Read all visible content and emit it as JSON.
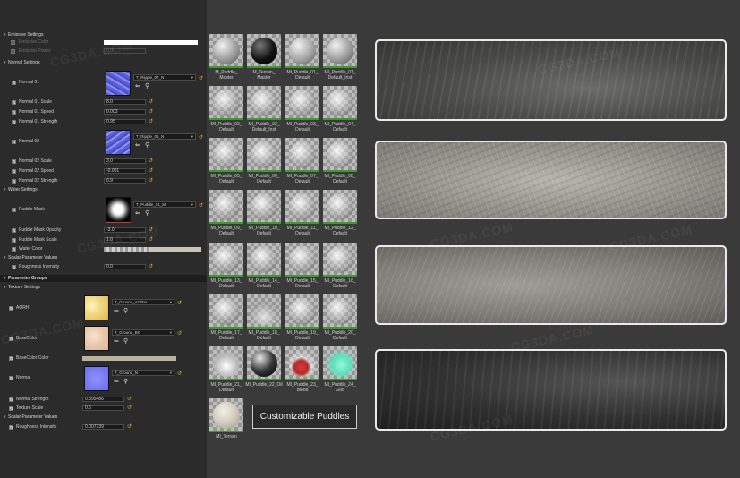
{
  "left_panel": {
    "emissive": {
      "section": "Emissive Settings",
      "color_label": "Emissive Color",
      "power_label": "Emissive Power",
      "power_value": "0.0"
    },
    "normal": {
      "section": "Normal Settings",
      "n1_label": "Normal 01",
      "n1_texture": "T_Ripple_07_N",
      "n1_scale_label": "Normal 01 Scale",
      "n1_scale": "8.0",
      "n1_speed_label": "Normal 01 Speed",
      "n1_speed": "0.003",
      "n1_strength_label": "Normal 01 Strength",
      "n1_strength": "0.95",
      "n2_label": "Normal 02",
      "n2_texture": "T_Ripple_05_N",
      "n2_scale_label": "Normal 02 Scale",
      "n2_scale": "3.0",
      "n2_speed_label": "Normal 02 Speed",
      "n2_speed": "-0.001",
      "n2_strength_label": "Normal 02 Strength",
      "n2_strength": "0.9"
    },
    "water": {
      "section": "Water Settings",
      "mask_label": "Puddle Mask",
      "mask_texture": "T_Puddle_01_M",
      "opacity_label": "Puddle Mask Opacity",
      "opacity": "-3.0",
      "mscale_label": "Puddle Mask Scale",
      "mscale": "1.0",
      "color_label": "Water Color"
    },
    "scalar1": {
      "section": "Scalar Parameter Values",
      "rough_label": "Roughness Intensity",
      "rough": "0.0"
    },
    "groups_header": "Parameter Groups",
    "texture": {
      "section": "Texture Settings",
      "aorh_label": "AORH",
      "aorh_texture": "T_Ground_AORH",
      "base_label": "BaseColor",
      "base_texture": "T_Ground_BC",
      "basecolor_label": "BaseColor Color",
      "normal_label": "Normal",
      "normal_texture": "T_Ground_N",
      "nstrength_label": "Normal Strength",
      "nstrength": "0.395486",
      "tscale_label": "Texture Scale",
      "tscale": "0.6"
    },
    "scalar2": {
      "section": "Scalar Parameter Values",
      "rough_label": "Roughness Intensity",
      "rough": "0.007339"
    }
  },
  "assets": [
    [
      "M_Puddle_",
      "Master"
    ],
    [
      "M_Terrain_",
      "Master"
    ],
    [
      "MI_Puddle_01_",
      "Default"
    ],
    [
      "MI_Puddle_01_",
      "Default_Inst"
    ],
    [
      "MI_Puddle_02_",
      "Default"
    ],
    [
      "MI_Puddle_02_",
      "Default_Inst"
    ],
    [
      "MI_Puddle_03_",
      "Default"
    ],
    [
      "MI_Puddle_04_",
      "Default"
    ],
    [
      "MI_Puddle_05_",
      "Default"
    ],
    [
      "MI_Puddle_06_",
      "Default"
    ],
    [
      "MI_Puddle_07_",
      "Default"
    ],
    [
      "MI_Puddle_08_",
      "Default"
    ],
    [
      "MI_Puddle_09_",
      "Default"
    ],
    [
      "MI_Puddle_10_",
      "Default"
    ],
    [
      "MI_Puddle_11_",
      "Default"
    ],
    [
      "MI_Puddle_12_",
      "Default"
    ],
    [
      "MI_Puddle_13_",
      "Default"
    ],
    [
      "MI_Puddle_14_",
      "Default"
    ],
    [
      "MI_Puddle_15_",
      "Default"
    ],
    [
      "MI_Puddle_16_",
      "Default"
    ],
    [
      "MI_Puddle_17_",
      "Default"
    ],
    [
      "MI_Puddle_18_",
      "Default"
    ],
    [
      "MI_Puddle_19_",
      "Default"
    ],
    [
      "MI_Puddle_20_",
      "Default"
    ],
    [
      "MI_Puddle_21_",
      "Default"
    ],
    [
      "MI_Puddle_22_Oil",
      ""
    ],
    [
      "MI_Puddle_23_",
      "Blood"
    ],
    [
      "MI_Puddle_24_",
      "Goo"
    ],
    [
      "MI_Terrain",
      ""
    ]
  ],
  "title_box": "Customizable Puddles",
  "watermark": "CG3DA.COM",
  "colors": {
    "accent_reset": "#d7b53a",
    "selected_bar": "#3c9b2c",
    "panel_bg": "#2b2b2b"
  }
}
